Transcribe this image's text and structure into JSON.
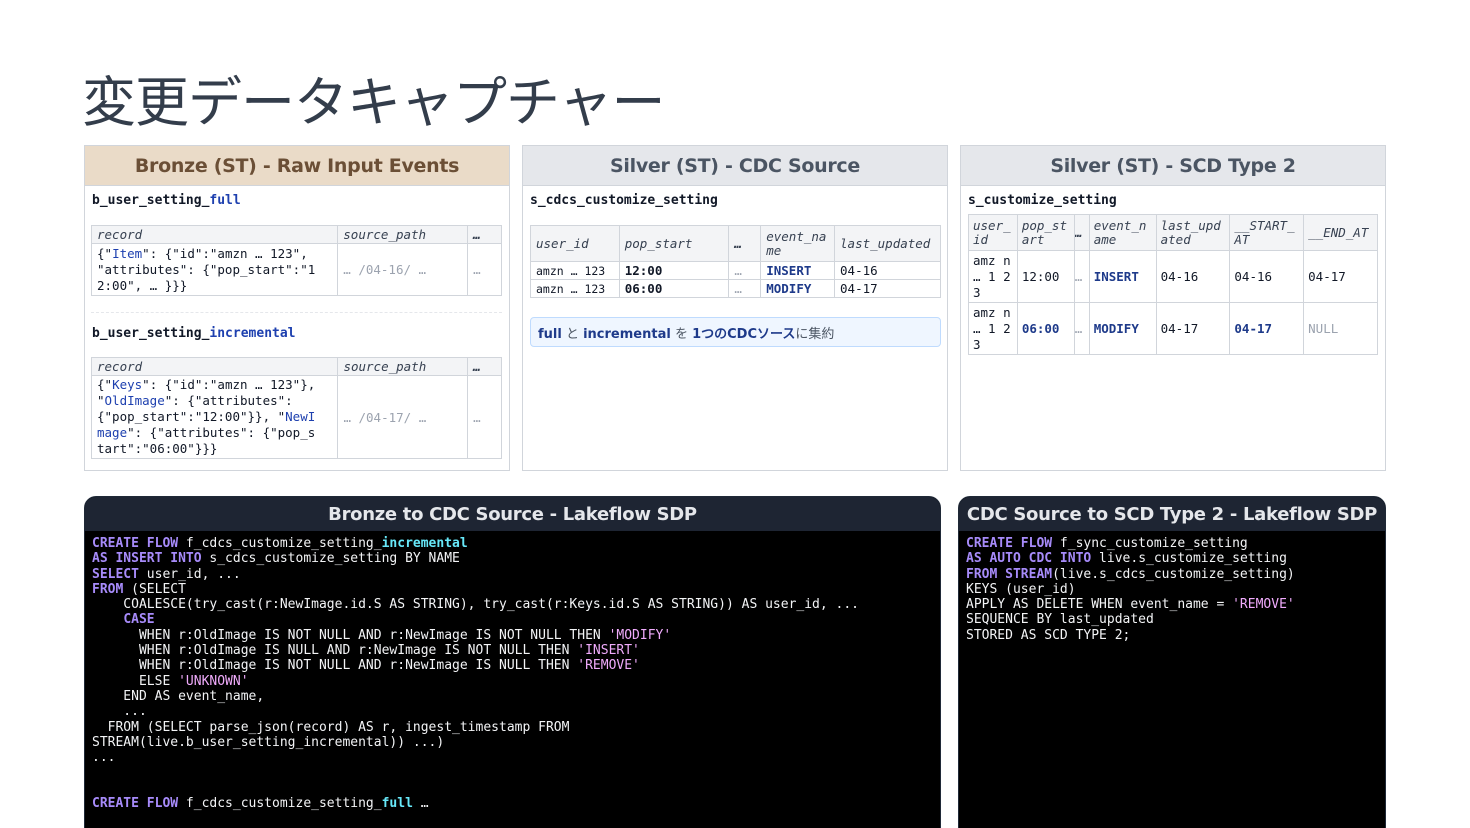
{
  "page_title": "変更データキャプチャー",
  "bronze": {
    "header": "Bronze (ST) - Raw Input Events",
    "full_table": {
      "name_prefix": "b_user_setting_",
      "name_suffix": "full",
      "headers": [
        "record",
        "source_path",
        "…"
      ],
      "row": {
        "record_line1_a": "{\"",
        "record_line1_key": "Item",
        "record_line1_b": "\": {\"id\":\"amzn … 123\",",
        "record_line2": "\"attributes\": {\"pop_start\":\"1",
        "record_line3": "2:00\",  … }}}",
        "source_path": "… /04-16/ …",
        "more": "…"
      }
    },
    "incremental_table": {
      "name_prefix": "b_user_setting_",
      "name_suffix": "incremental",
      "headers": [
        "record",
        "source_path",
        "…"
      ],
      "row": {
        "l1a": "{\"",
        "l1k": "Keys",
        "l1b": "\": {\"id\":\"amzn … 123\"},",
        "l2a": "\"",
        "l2k": "OldImage",
        "l2b": "\": {\"attributes\":",
        "l3a": "{\"pop_start\":\"12:00\"}}, \"",
        "l3k": "NewI",
        "l4k": "mage",
        "l4b": "\": {\"attributes\": {\"pop_s",
        "l5": "tart\":\"06:00\"}}}",
        "source_path": "… /04-17/ …",
        "more": "…"
      }
    }
  },
  "silver_cdc": {
    "header": "Silver (ST) - CDC Source",
    "table_name": "s_cdcs_customize_setting",
    "headers": [
      "user_id",
      "pop_start",
      "…",
      "event_na me",
      "last_updated"
    ],
    "rows": [
      {
        "user_id": "amzn … 123",
        "pop_start": "12:00",
        "more": "…",
        "event_name": "INSERT",
        "last_updated": "04-16"
      },
      {
        "user_id": "amzn … 123",
        "pop_start": "06:00",
        "more": "…",
        "event_name": "MODIFY",
        "last_updated": "04-17"
      }
    ],
    "note": {
      "a": "full",
      "b": " と ",
      "c": "incremental",
      "d": " を ",
      "e": "1つのCDCソース",
      "f": "に集約"
    }
  },
  "silver_scd": {
    "header": "Silver (ST) - SCD Type 2",
    "table_name": "s_customize_setting",
    "headers": [
      "user_ id",
      "pop_st art",
      "…",
      "event_n ame",
      "last_upd ated",
      "__START_ AT",
      "__END_AT"
    ],
    "rows": [
      {
        "user_id": "amz n … 1 23",
        "pop_start": "12:00",
        "more": "…",
        "event_name": "INSERT",
        "last_updated": "04-16",
        "start_at": "04-16",
        "end_at": "04-17"
      },
      {
        "user_id": "amz n … 1 23",
        "pop_start": "06:00",
        "more": "…",
        "event_name": "MODIFY",
        "last_updated": "04-17",
        "start_at": "04-17",
        "end_at": "NULL"
      }
    ]
  },
  "code1": {
    "header": "Bronze to CDC Source - Lakeflow SDP"
  },
  "code2": {
    "header": "CDC Source to SCD Type 2 - Lakeflow SDP"
  }
}
